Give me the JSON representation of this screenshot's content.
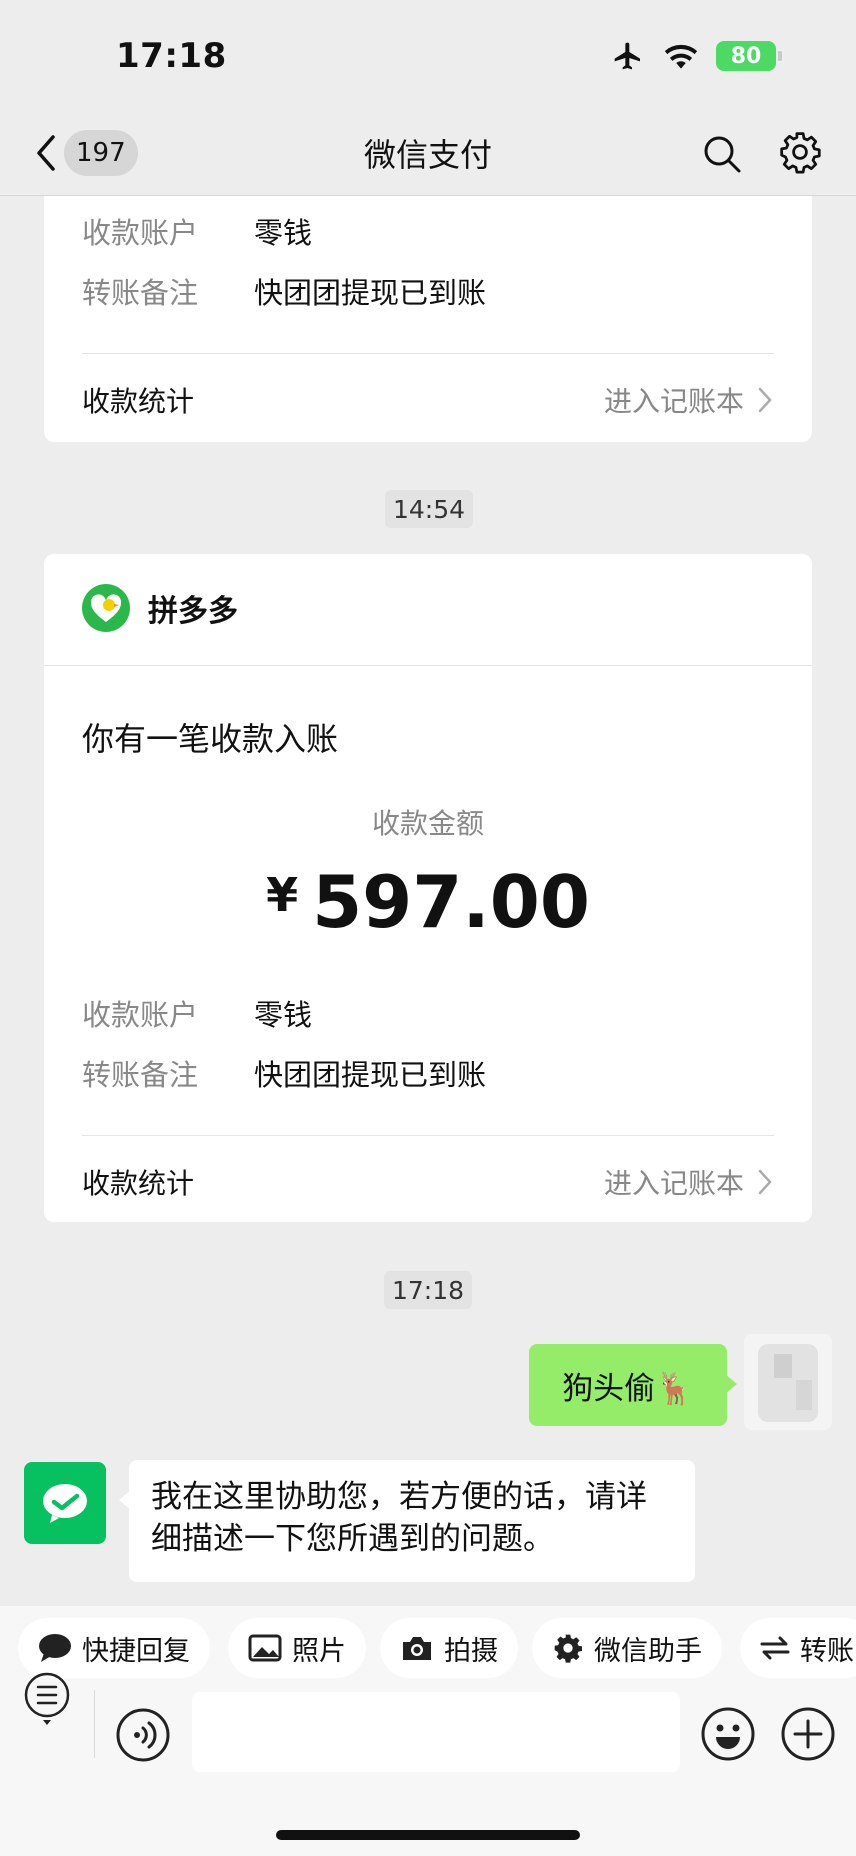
{
  "status_bar": {
    "time": "17:18",
    "battery": "80"
  },
  "nav": {
    "back_count": "197",
    "title": "微信支付"
  },
  "card_top": {
    "rows": [
      {
        "label": "收款账户",
        "value": "零钱"
      },
      {
        "label": "转账备注",
        "value": "快团团提现已到账"
      }
    ],
    "stat_label": "收款统计",
    "stat_link": "进入记账本"
  },
  "timestamp_1": "14:54",
  "card_main": {
    "sender": "拼多多",
    "headline": "你有一笔收款入账",
    "amount_label": "收款金额",
    "currency": "¥",
    "amount": "597.00",
    "rows": [
      {
        "label": "收款账户",
        "value": "零钱"
      },
      {
        "label": "转账备注",
        "value": "快团团提现已到账"
      }
    ],
    "stat_label": "收款统计",
    "stat_link": "进入记账本"
  },
  "timestamp_2": "17:18",
  "messages": {
    "outgoing": "狗头偷🦌",
    "incoming": "我在这里协助您，若方便的话，请详细描述一下您所遇到的问题。"
  },
  "quick_replies": [
    {
      "icon": "chat-bubble-icon",
      "label": "快捷回复"
    },
    {
      "icon": "image-icon",
      "label": "照片"
    },
    {
      "icon": "camera-icon",
      "label": "拍摄"
    },
    {
      "icon": "gear-icon",
      "label": "微信助手"
    },
    {
      "icon": "transfer-icon",
      "label": "转账"
    }
  ],
  "colors": {
    "wechat_green": "#07c160",
    "bubble_green": "#95ec69",
    "background": "#ededed"
  }
}
